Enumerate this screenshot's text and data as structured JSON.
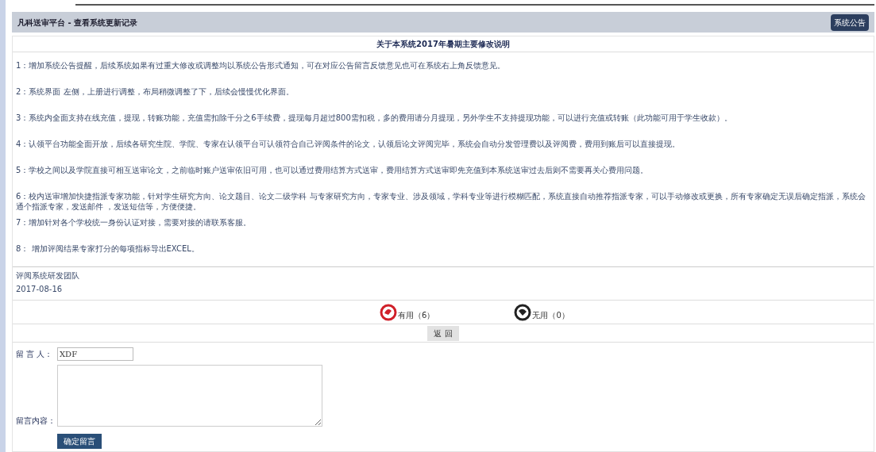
{
  "header": {
    "title": "凡科送审平台 - 查看系统更新记录",
    "button": "系统公告"
  },
  "notice": {
    "title": "关于本系统2017年暑期主要修改说明",
    "items": [
      "1：增加系统公告提醒，后续系统如果有过重大修改或调整均以系统公告形式通知，可在对应公告留言反馈意见也可在系统右上角反馈意见。",
      "2：系统界面 左侧，上册进行调整，布局稍微调整了下，后续会慢慢优化界面。",
      "3：系统内全面支持在线充值，提现，转账功能，充值需扣除千分之6手续费，提现每月超过800需扣税，多的费用请分月提现，另外学生不支持提现功能，可以进行充值或转账（此功能可用于学生收款）。",
      "4：认领平台功能全面开放，后续各研究生院、学院、专家在认领平台可认领符合自己评阅条件的论文，认领后论文评阅完毕，系统会自动分发管理费以及评阅费，费用到账后可以直接提现。",
      "5：学校之间以及学院直接可相互送审论文，之前临时账户送审依旧可用，也可以通过费用结算方式送审，费用结算方式送审即先充值到本系统送审过去后则不需要再关心费用问题。",
      "6：校内送审增加快捷指派专家功能，针对学生研究方向、论文题目、论文二级学科 与专家研究方向，专家专业、涉及领域，学科专业等进行模糊匹配，系统直接自动推荐指派专家，可以手动修改或更换，所有专家确定无误后确定指派，系统会通个指派专家，发送邮件 ，发送短信等，方便便捷。",
      "7：增加针对各个学校统一身份认证对接，需要对接的请联系客服。",
      "8： 增加评阅结果专家打分的每项指标导出EXCEL。"
    ],
    "author": "评阅系统研发团队",
    "date": "2017-08-16"
  },
  "feedback": [
    {
      "kind": "useful",
      "label": "有用（6）"
    },
    {
      "kind": "useless",
      "label": "无用（0）"
    }
  ],
  "back_button": "返 回",
  "form": {
    "name_label": "留 言 人：",
    "name_value": "XDF",
    "content_label": "留言内容：",
    "submit": "确定留言"
  }
}
